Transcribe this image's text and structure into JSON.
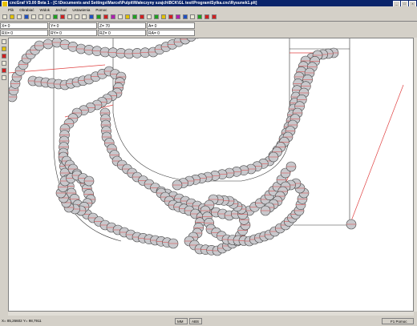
{
  "window": {
    "title": "cncGraf V3.00 Beta 1 - [C:\\Documents and Settings\\Marcel\\Pulpit\\Wałeczyny szajch\\BCK\\GL test\\Program\\Sylka.cnc\\Rysunek1.plt]"
  },
  "menu": [
    "Plik",
    "Obrabiać",
    "Widok",
    "Jechać",
    "Ustawienia",
    "Pomoc"
  ],
  "coords": {
    "x": "X= 0",
    "y": "Y= 0",
    "z": "Z= 70",
    "a": "A= 0",
    "rx": "RX= 0",
    "ry": "RY= 0",
    "rz": "RZ= 0",
    "ra": "RA= 0"
  },
  "status": {
    "position": "X= 85,26602 Y= 98,7911",
    "mm": "MM",
    "abs": "ABS",
    "help": "F1 Pomoc"
  },
  "icons": {
    "toolbar": [
      "new-icon",
      "open-icon",
      "save-icon",
      "undo-icon",
      "cut-icon",
      "copy-icon",
      "paste-icon",
      "zoom-in-icon",
      "zoom-out-icon",
      "zoom-fit-icon",
      "grid-icon",
      "select-icon",
      "pen-icon",
      "line-icon",
      "circle-icon",
      "rect-icon",
      "text-icon",
      "move-icon",
      "rotate-icon",
      "mirror-icon",
      "scale-icon",
      "play-icon",
      "pause-icon",
      "stop-icon",
      "step-icon",
      "home-icon",
      "settings-icon",
      "axis-icon",
      "delete-icon",
      "cross-icon"
    ],
    "side": [
      "tool-1-icon",
      "tool-2-icon",
      "tool-3-icon",
      "tool-4-icon",
      "tool-5-icon",
      "tool-6-icon"
    ]
  }
}
